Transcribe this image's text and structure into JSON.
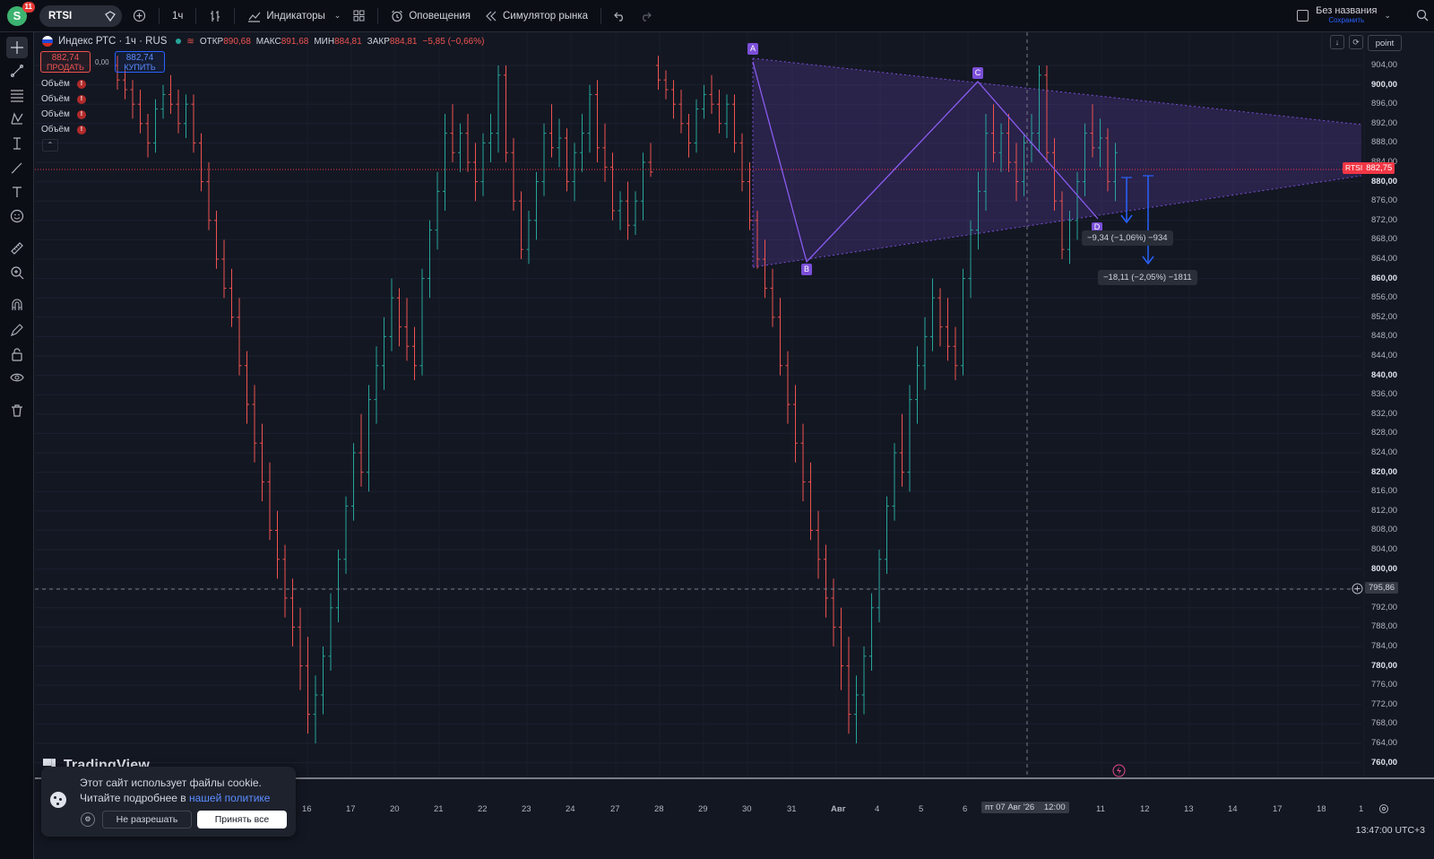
{
  "topbar": {
    "avatar_letter": "S",
    "notif_count": "11",
    "symbol": "RTSI",
    "interval": "1ч",
    "indicators_label": "Индикаторы",
    "alerts_label": "Оповещения",
    "replay_label": "Симулятор рынка",
    "layout_name": "Без названия",
    "layout_save": "Сохранить"
  },
  "legend": {
    "title": "Индекс РТС · 1ч · RUS",
    "open_label": "ОТКР",
    "open": "890,68",
    "high_label": "МАКС",
    "high": "891,68",
    "low_label": "МИН",
    "low": "884,81",
    "close_label": "ЗАКР",
    "close": "884,81",
    "change": "−5,85 (−0,66%)"
  },
  "trade": {
    "sell_price": "882,74",
    "sell_label": "ПРОДАТЬ",
    "spread": "0,00",
    "buy_price": "882,74",
    "buy_label": "КУПИТЬ"
  },
  "volumes": [
    "Объём",
    "Объём",
    "Объём",
    "Объём"
  ],
  "top_right": {
    "point_label": "point"
  },
  "price_axis": {
    "ticks": [
      "904,00",
      "900,00",
      "896,00",
      "892,00",
      "888,00",
      "884,00",
      "880,00",
      "876,00",
      "872,00",
      "868,00",
      "864,00",
      "860,00",
      "856,00",
      "852,00",
      "848,00",
      "844,00",
      "840,00",
      "836,00",
      "832,00",
      "828,00",
      "824,00",
      "820,00",
      "816,00",
      "812,00",
      "808,00",
      "804,00",
      "800,00",
      "796,00",
      "792,00",
      "788,00",
      "784,00",
      "780,00",
      "776,00",
      "772,00",
      "768,00",
      "764,00",
      "760,00"
    ],
    "last_symbol": "RTSI",
    "last_price": "882,75",
    "cursor_price": "795,86"
  },
  "time_axis": {
    "ticks": [
      "16",
      "17",
      "20",
      "21",
      "22",
      "23",
      "24",
      "27",
      "28",
      "29",
      "30",
      "31",
      "Авг",
      "4",
      "5",
      "6",
      "11",
      "12",
      "13",
      "14",
      "17",
      "18",
      "1"
    ],
    "cursor_label": "пт 07 Авг '26",
    "cursor_time": "12:00"
  },
  "pattern": {
    "labels": [
      "A",
      "B",
      "C",
      "D"
    ]
  },
  "measures": {
    "m1": "−9,34 (−1,06%) −934",
    "m2": "−18,11 (−2,05%) −1811"
  },
  "watermark": "TradingView",
  "clock": "13:47:00 UTC+3",
  "cookie": {
    "line1": "Этот сайт использует файлы cookie.",
    "line2": "Читайте подробнее в ",
    "link": "нашей политике",
    "deny": "Не разрешать",
    "accept": "Принять все"
  },
  "colors": {
    "up": "#26a69a",
    "down": "#ef5350",
    "pattern": "#7b4fd8",
    "accent": "#2962ff",
    "bg": "#131722"
  },
  "chart_data": {
    "type": "bar",
    "candles": [
      [
        904,
        906,
        899,
        901
      ],
      [
        901,
        903,
        897,
        899
      ],
      [
        899,
        901,
        893,
        896
      ],
      [
        896,
        899,
        890,
        892
      ],
      [
        892,
        894,
        885,
        888
      ],
      [
        888,
        897,
        886,
        895
      ],
      [
        895,
        900,
        893,
        898
      ],
      [
        898,
        902,
        894,
        896
      ],
      [
        896,
        899,
        890,
        892
      ],
      [
        892,
        898,
        889,
        896
      ],
      [
        896,
        898,
        886,
        888
      ],
      [
        888,
        890,
        878,
        880
      ],
      [
        880,
        884,
        870,
        872
      ],
      [
        872,
        874,
        862,
        864
      ],
      [
        864,
        868,
        856,
        858
      ],
      [
        858,
        862,
        850,
        852
      ],
      [
        852,
        856,
        840,
        842
      ],
      [
        842,
        845,
        830,
        834
      ],
      [
        834,
        838,
        822,
        826
      ],
      [
        826,
        830,
        814,
        818
      ],
      [
        818,
        822,
        806,
        808
      ],
      [
        808,
        812,
        798,
        802
      ],
      [
        802,
        805,
        790,
        794
      ],
      [
        794,
        798,
        784,
        788
      ],
      [
        788,
        792,
        775,
        780
      ],
      [
        780,
        786,
        766,
        770
      ],
      [
        770,
        778,
        764,
        774
      ],
      [
        774,
        784,
        770,
        782
      ],
      [
        782,
        795,
        779,
        792
      ],
      [
        792,
        804,
        789,
        802
      ],
      [
        802,
        815,
        799,
        813
      ],
      [
        813,
        826,
        810,
        824
      ],
      [
        824,
        832,
        817,
        820
      ],
      [
        820,
        838,
        816,
        835
      ],
      [
        835,
        846,
        830,
        842
      ],
      [
        842,
        852,
        837,
        848
      ],
      [
        848,
        860,
        845,
        856
      ],
      [
        856,
        858,
        846,
        850
      ],
      [
        850,
        856,
        843,
        846
      ],
      [
        846,
        850,
        839,
        842
      ],
      [
        842,
        862,
        840,
        860
      ],
      [
        860,
        872,
        856,
        870
      ],
      [
        870,
        882,
        866,
        878
      ],
      [
        878,
        894,
        874,
        890
      ],
      [
        890,
        896,
        884,
        886
      ],
      [
        886,
        892,
        882,
        890
      ],
      [
        890,
        894,
        882,
        884
      ],
      [
        884,
        888,
        876,
        880
      ],
      [
        880,
        890,
        877,
        888
      ],
      [
        888,
        894,
        884,
        890
      ],
      [
        890,
        904,
        886,
        902
      ],
      [
        902,
        904,
        884,
        886
      ],
      [
        886,
        889,
        874,
        876
      ],
      [
        876,
        878,
        864,
        866
      ],
      [
        866,
        874,
        863,
        872
      ],
      [
        872,
        882,
        868,
        880
      ],
      [
        880,
        892,
        877,
        890
      ],
      [
        890,
        896,
        885,
        887
      ],
      [
        887,
        893,
        883,
        889
      ],
      [
        889,
        891,
        878,
        880
      ],
      [
        880,
        888,
        876,
        886
      ],
      [
        886,
        894,
        882,
        890
      ],
      [
        890,
        900,
        886,
        898
      ],
      [
        898,
        901,
        884,
        887
      ],
      [
        887,
        892,
        880,
        883
      ],
      [
        883,
        886,
        872,
        874
      ],
      [
        874,
        878,
        870,
        876
      ],
      [
        876,
        880,
        868,
        871
      ],
      [
        871,
        878,
        869,
        876
      ],
      [
        876,
        886,
        872,
        884
      ],
      [
        884,
        888,
        881,
        882
      ]
    ],
    "ylim": [
      758,
      906
    ]
  }
}
